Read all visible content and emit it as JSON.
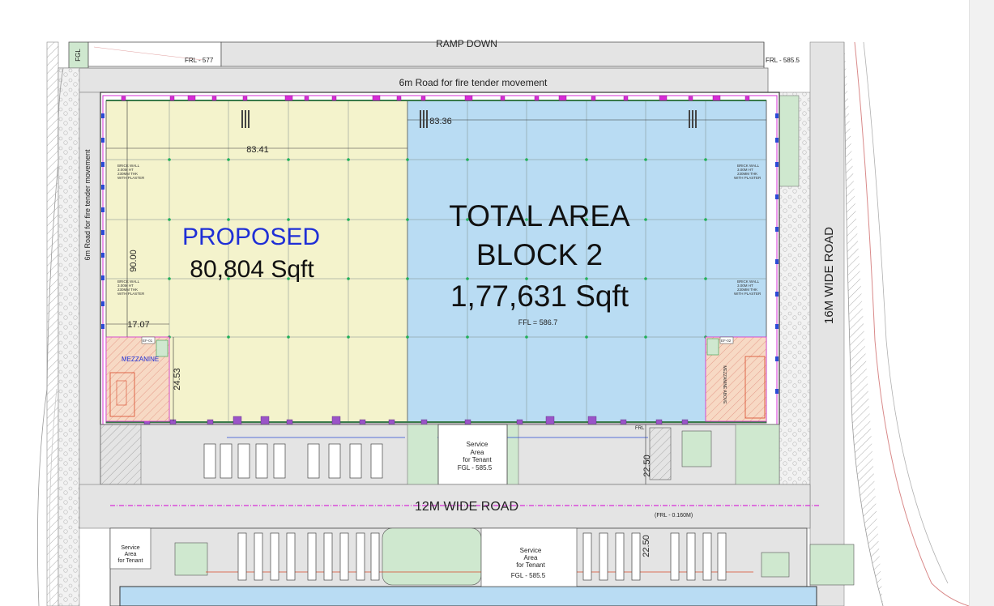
{
  "colors": {
    "proposed_fill": "#f4f3cc",
    "total_fill": "#b9dcf3",
    "green_patch": "#cfe8cf",
    "road": "#e4e4e4",
    "mezzanine": "#f7d9c4",
    "magenta": "#d62cd6",
    "proposed_text": "#1f2fd6"
  },
  "labels": {
    "ramp_down": "RAMP DOWN",
    "fgl_corner": "FGL",
    "frl_577": "FRL - 577",
    "frl_5855": "FRL - 585.5",
    "road_fire_top": "6m Road for fire tender movement",
    "road_fire_left": "6m Road for fire tender movement",
    "wide_road_16": "16M WIDE ROAD",
    "wide_road_12": "12M WIDE ROAD",
    "frl_0160": "(FRL - 0.160M)",
    "frl_small": "FRL"
  },
  "proposed": {
    "title": "PROPOSED",
    "area": "80,804 Sqft"
  },
  "total": {
    "line1": "TOTAL AREA",
    "line2": "BLOCK 2",
    "area": "1,77,631 Sqft",
    "ffl": "FFL = 586.7"
  },
  "dimensions": {
    "width_left": "83.41",
    "width_right": "83.36",
    "height": "90.00",
    "mezz_width": "17.07",
    "mezz_height": "24.53",
    "ramp_len1": "22.50",
    "ramp_len2": "22.50"
  },
  "mezzanine": {
    "label": "MEZZANINE",
    "ef_left": "EF-01",
    "ef_right": "EF-02",
    "right_text": "MEZZANINE ABOVE"
  },
  "brick_wall": {
    "line1": "BRICK WALL",
    "line2": "3.00M HT",
    "line3": "230MM THK",
    "line4": "WITH PLASTER"
  },
  "service_top": {
    "line1": "Service",
    "line2": "Area",
    "line3": "for Tenant",
    "line4": "FGL - 585.5"
  },
  "service_bottom_left": {
    "line1": "Service",
    "line2": "Area",
    "line3": "for Tenant"
  },
  "service_bottom_mid": {
    "line1": "Service",
    "line2": "Area",
    "line3": "for Tenant",
    "line4": "FGL - 585.5"
  }
}
